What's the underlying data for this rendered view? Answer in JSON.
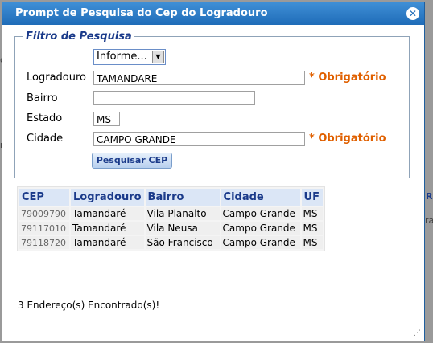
{
  "background": {
    "fragments": [
      "o",
      "n",
      "R",
      "ra"
    ]
  },
  "dialog": {
    "title": "Prompt de Pesquisa do Cep do Logradouro",
    "close_glyph": "✕"
  },
  "filter": {
    "legend": "Filtro de Pesquisa",
    "select": {
      "value": "Informe...",
      "arrow": "▼"
    },
    "logradouro": {
      "label": "Logradouro",
      "value": "TAMANDARE",
      "required": "* Obrigatório"
    },
    "bairro": {
      "label": "Bairro",
      "value": ""
    },
    "estado": {
      "label": "Estado",
      "value": "MS"
    },
    "cidade": {
      "label": "Cidade",
      "value": "CAMPO GRANDE",
      "required": "* Obrigatório"
    },
    "search_button": "Pesquisar CEP"
  },
  "results": {
    "columns": [
      "CEP",
      "Logradouro",
      "Bairro",
      "Cidade",
      "UF"
    ],
    "rows": [
      [
        "79009790",
        "Tamandaré",
        "Vila Planalto",
        "Campo Grande",
        "MS"
      ],
      [
        "79117010",
        "Tamandaré",
        "Vila Neusa",
        "Campo Grande",
        "MS"
      ],
      [
        "79118720",
        "Tamandaré",
        "São Francisco",
        "Campo Grande",
        "MS"
      ]
    ]
  },
  "status": "3 Endereço(s) Encontrado(s)!",
  "colors": {
    "titlebar": "#1f6cb8",
    "required": "#e06000",
    "header_text": "#1a3a8a"
  }
}
